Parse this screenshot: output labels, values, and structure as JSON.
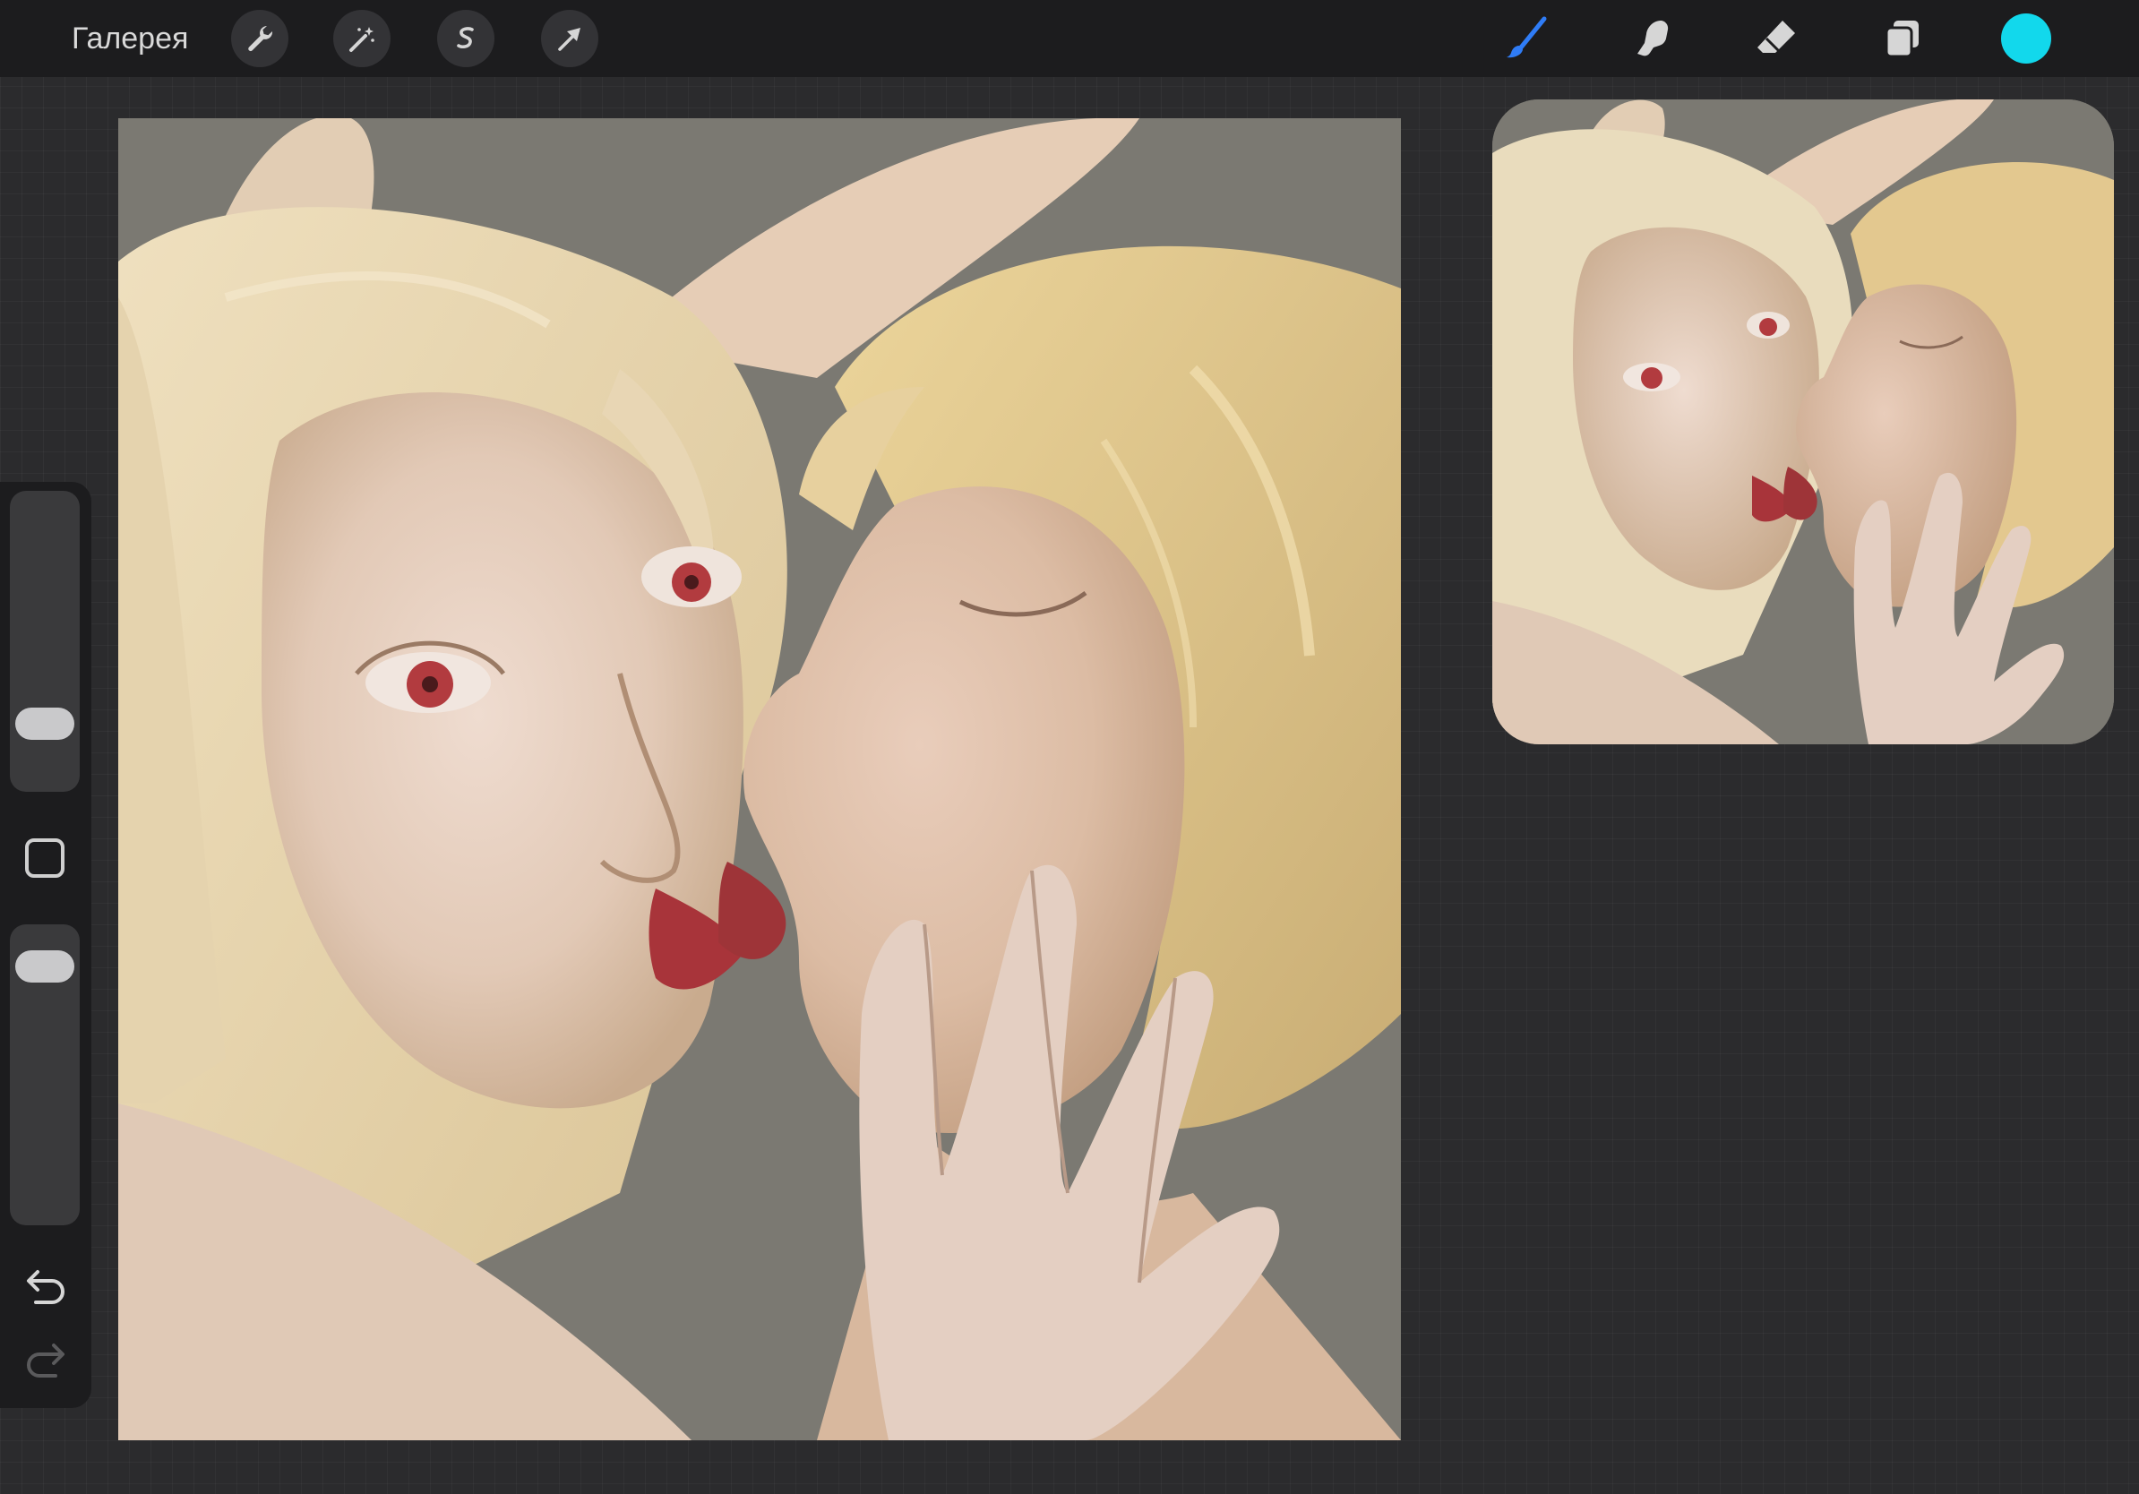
{
  "toolbar": {
    "gallery_label": "Галерея",
    "left_tools": [
      {
        "name": "actions",
        "icon": "wrench-icon"
      },
      {
        "name": "adjustments",
        "icon": "magic-wand-icon"
      },
      {
        "name": "selection",
        "icon": "selection-s-icon"
      },
      {
        "name": "transform",
        "icon": "arrow-cursor-icon"
      }
    ],
    "right_tools": [
      {
        "name": "brush",
        "icon": "brush-icon",
        "active": true
      },
      {
        "name": "smudge",
        "icon": "smudge-finger-icon",
        "active": false
      },
      {
        "name": "eraser",
        "icon": "eraser-icon",
        "active": false
      },
      {
        "name": "layers",
        "icon": "layers-icon",
        "active": false
      }
    ],
    "current_color": "#12d8ec"
  },
  "sidebar": {
    "brush_size_level": 0.18,
    "opacity_level": 0.92,
    "modify_icon": "square-modify-icon",
    "undo_icon": "undo-arrow-icon",
    "redo_icon": "redo-arrow-icon"
  },
  "canvas": {
    "background_color": "#7d7b74",
    "artwork": "painting-two-figures"
  },
  "reference_window": {
    "artwork": "painting-two-figures-reference"
  },
  "colors": {
    "toolbar_bg": "#1c1c1e",
    "active_tool": "#2f7cf6",
    "icon": "#d6d6d6",
    "skin": "#e5cfc0",
    "hair": "#dcc595",
    "lips": "#a8343a",
    "eye": "#b4353c"
  }
}
